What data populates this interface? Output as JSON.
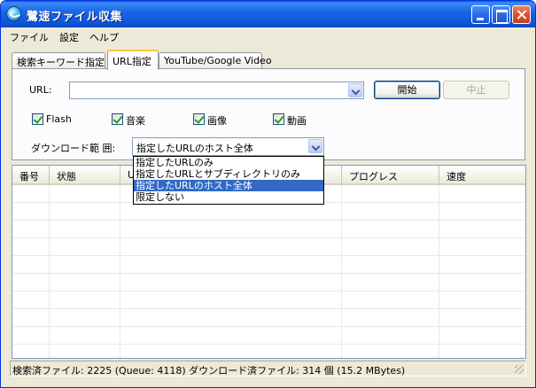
{
  "window": {
    "title": "鷺速ファイル収集"
  },
  "menu": {
    "items": [
      "ファイル",
      "設定",
      "ヘルプ"
    ]
  },
  "tabs": [
    {
      "label": "検索キーワード指定"
    },
    {
      "label": "URL指定",
      "active": true
    },
    {
      "label": "YouTube/Google Video"
    }
  ],
  "url_panel": {
    "url_label": "URL:",
    "url_value": "",
    "start_button": "開始",
    "stop_button": "中止",
    "checkboxes": [
      {
        "label": "Flash",
        "checked": true
      },
      {
        "label": "音楽",
        "checked": true
      },
      {
        "label": "画像",
        "checked": true
      },
      {
        "label": "動画",
        "checked": true
      }
    ],
    "range_label": "ダウンロード範 囲:",
    "range_selected": "指定したURLのホスト全体",
    "range_options": [
      "指定したURLのみ",
      "指定したURLとサブディレクトリのみ",
      "指定したURLのホスト全体",
      "限定しない"
    ]
  },
  "list": {
    "columns": [
      "番号",
      "状態",
      "U",
      "プログレス",
      "速度"
    ]
  },
  "status": {
    "text": "検索済ファイル: 2225 (Queue: 4118)  ダウンロード済ファイル: 314 個 (15.2 MBytes)"
  },
  "colors": {
    "titlebar": "#0b53d6",
    "selection": "#316ac5",
    "window_bg": "#ece9d8"
  }
}
